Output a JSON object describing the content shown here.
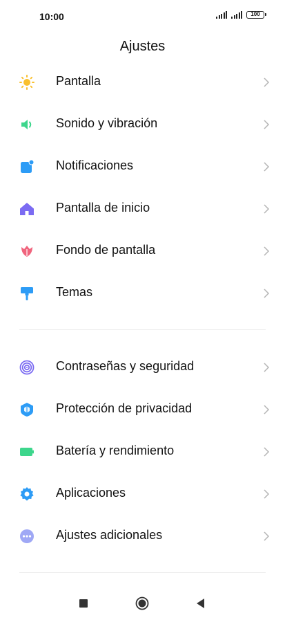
{
  "status_bar": {
    "time": "10:00",
    "battery": "100"
  },
  "header": {
    "title": "Ajustes"
  },
  "groups": [
    {
      "items": [
        {
          "label": "Pantalla",
          "icon": "sun-icon",
          "color": "#F9C02E"
        },
        {
          "label": "Sonido y vibración",
          "icon": "speaker-icon",
          "color": "#3DD68C"
        },
        {
          "label": "Notificaciones",
          "icon": "notification-icon",
          "color": "#2D9CF6"
        },
        {
          "label": "Pantalla de inicio",
          "icon": "home-icon",
          "color": "#7B6BF2"
        },
        {
          "label": "Fondo de pantalla",
          "icon": "tulip-icon",
          "color": "#F0647D"
        },
        {
          "label": "Temas",
          "icon": "paint-roller-icon",
          "color": "#2D9CF6"
        }
      ]
    },
    {
      "items": [
        {
          "label": "Contraseñas y seguridad",
          "icon": "fingerprint-icon",
          "color": "#7B6BF2"
        },
        {
          "label": "Protección de privacidad",
          "icon": "shield-icon",
          "color": "#2D9CF6"
        },
        {
          "label": "Batería y rendimiento",
          "icon": "battery-icon",
          "color": "#3DD68C"
        },
        {
          "label": "Aplicaciones",
          "icon": "gear-icon",
          "color": "#2D9CF6"
        },
        {
          "label": "Ajustes adicionales",
          "icon": "more-icon",
          "color": "#9FA8F5"
        }
      ]
    }
  ],
  "nav_bar": {
    "buttons": [
      "recents-icon",
      "home-icon",
      "back-icon"
    ]
  }
}
